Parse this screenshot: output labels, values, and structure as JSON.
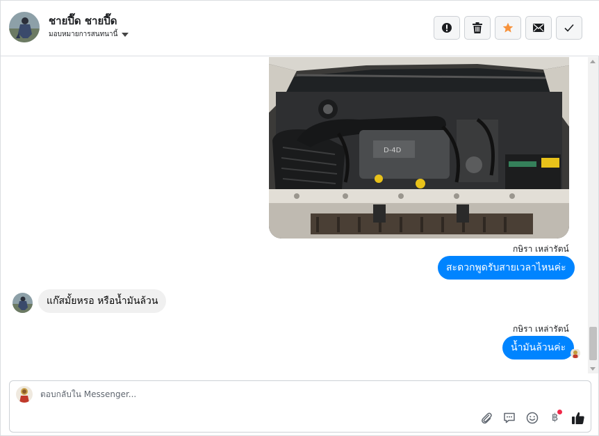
{
  "header": {
    "contact_name": "ชายปี๊ด ชายปี๊ด",
    "assign_label": "มอบหมายการสนทนานี้",
    "actions": [
      {
        "name": "spam-button",
        "icon": "alert-circle-icon"
      },
      {
        "name": "delete-button",
        "icon": "trash-icon"
      },
      {
        "name": "star-button",
        "icon": "star-icon",
        "color": "#f7923b"
      },
      {
        "name": "mark-unread-button",
        "icon": "envelope-icon"
      },
      {
        "name": "mark-done-button",
        "icon": "check-icon"
      }
    ]
  },
  "messages": [
    {
      "type": "image",
      "direction": "outgoing",
      "description": "engine-bay-photo"
    },
    {
      "type": "text",
      "direction": "outgoing",
      "sender": "กษิรา เหล่ารัตน์",
      "text": "สะดวกพูดรับสายเวลาไหนค่ะ"
    },
    {
      "type": "text",
      "direction": "incoming",
      "text": "แก๊สมั้ยหรอ หรือน้ำมันล้วน"
    },
    {
      "type": "text",
      "direction": "outgoing",
      "sender": "กษิรา เหล่ารัตน์",
      "text": "น้ำมันล้วนค่ะ"
    }
  ],
  "composer": {
    "placeholder": "ตอบกลับใน Messenger...",
    "tools": [
      "paperclip-icon",
      "chat-bubble-icon",
      "smiley-icon",
      "baht-icon",
      "thumbs-up-icon"
    ],
    "baht_symbol": "฿"
  },
  "colors": {
    "accent": "#0084ff",
    "incoming_bubble": "#f0f0f0",
    "notification": "#f02849"
  }
}
